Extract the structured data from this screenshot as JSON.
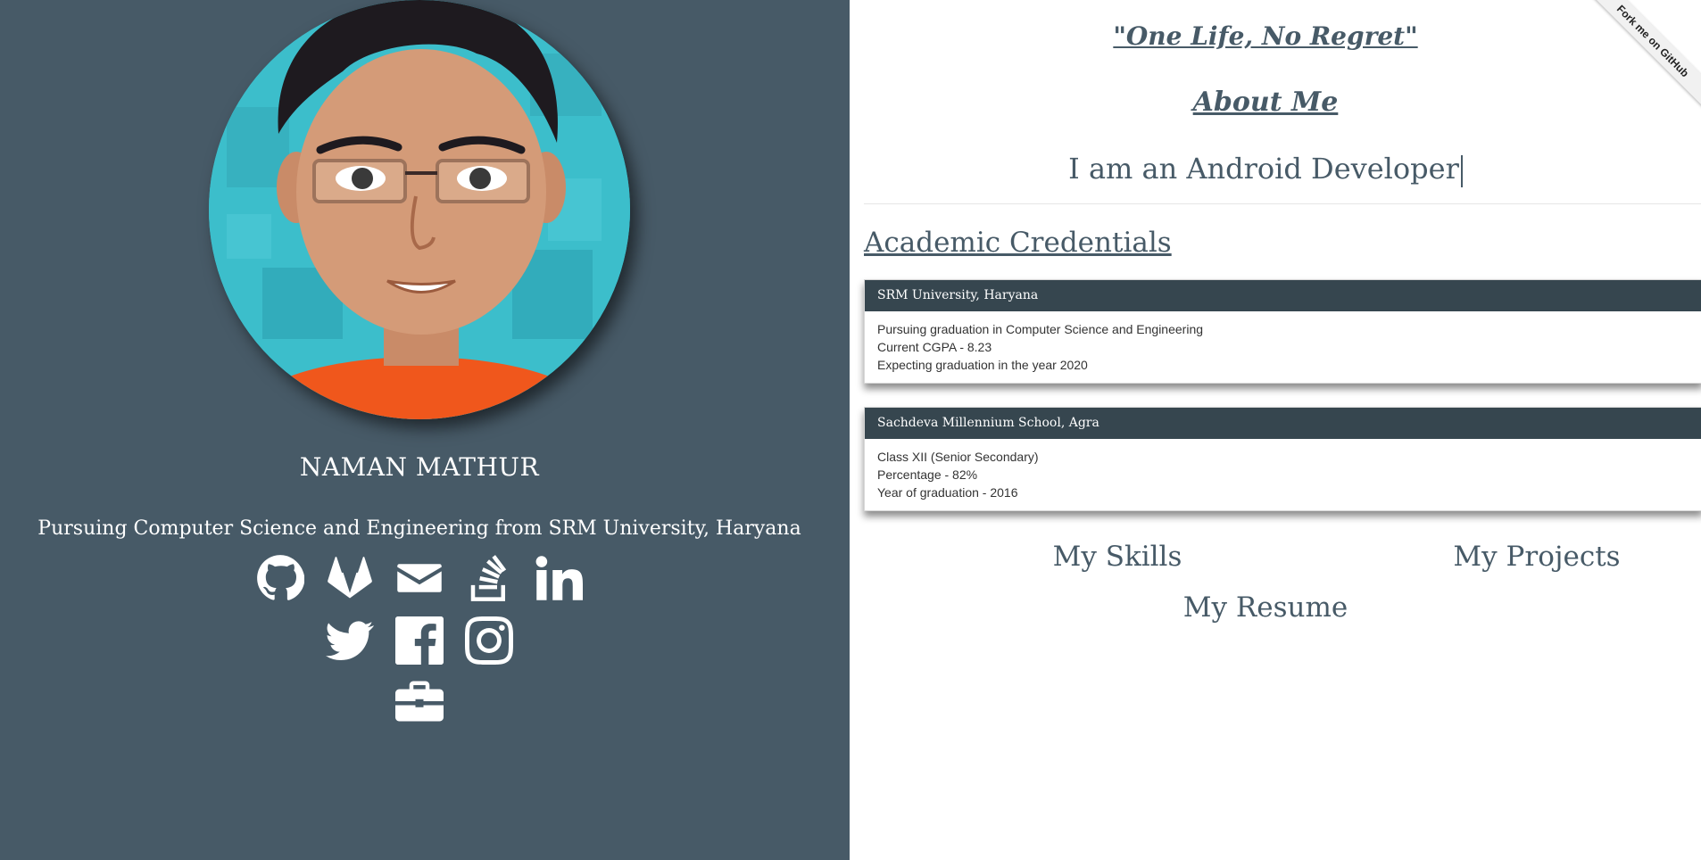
{
  "profile": {
    "name": "NAMAN MATHUR",
    "tagline": "Pursuing Computer Science and Engineering from SRM University, Haryana"
  },
  "social": {
    "row1": [
      "github-icon",
      "gitlab-icon",
      "envelope-icon",
      "stackoverflow-icon",
      "linkedin-icon"
    ],
    "row2": [
      "twitter-icon",
      "facebook-icon",
      "instagram-icon"
    ],
    "row3": [
      "briefcase-icon"
    ]
  },
  "header": {
    "quote": "\"One Life, No Regret\"",
    "about_title": "About Me",
    "typed_text": "I am an Android Developer"
  },
  "academic": {
    "title": "Academic Credentials",
    "cards": [
      {
        "institution": "SRM University, Haryana",
        "lines": [
          "Pursuing graduation in Computer Science and Engineering",
          "Current CGPA - 8.23",
          "Expecting graduation in the year 2020"
        ]
      },
      {
        "institution": "Sachdeva Millennium School, Agra",
        "lines": [
          "Class XII (Senior Secondary)",
          "Percentage - 82%",
          "Year of graduation - 2016"
        ]
      }
    ]
  },
  "links": {
    "skills": "My Skills",
    "projects": "My Projects",
    "resume": "My Resume"
  },
  "ribbon": {
    "label": "Fork me on GitHub"
  },
  "colors": {
    "sidebar_bg": "#475a67",
    "card_header_bg": "#36464f",
    "accent_text": "#475a67"
  }
}
